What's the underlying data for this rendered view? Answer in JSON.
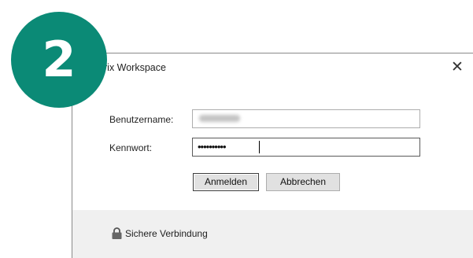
{
  "step_badge": {
    "number": "2",
    "color": "#0b8a76"
  },
  "dialog": {
    "title": "rix Workspace",
    "close_glyph": "✕",
    "close_icon": "close-icon",
    "form": {
      "username_label": "Benutzername:",
      "username_value": "",
      "password_label": "Kennwort:",
      "password_value": "••••••••••",
      "login_button": "Anmelden",
      "cancel_button": "Abbrechen"
    },
    "footer": {
      "lock_icon": "lock-icon",
      "text": "Sichere Verbindung"
    }
  }
}
